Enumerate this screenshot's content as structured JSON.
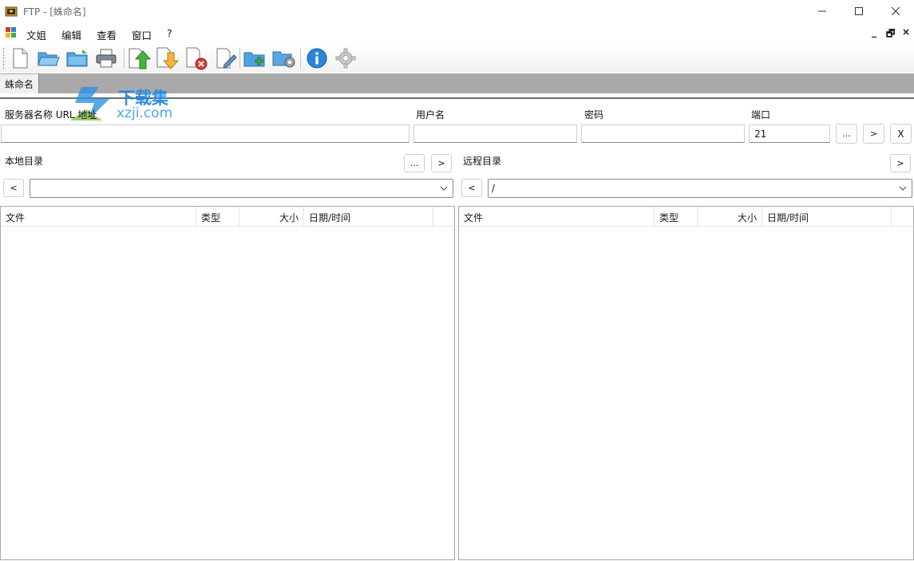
{
  "window": {
    "title": "FTP - [蛛命名]",
    "controls": [
      "minimize",
      "maximize",
      "close"
    ]
  },
  "menu": {
    "items": [
      "文姐",
      "编辑",
      "查看",
      "窗口",
      "?"
    ],
    "mdi": [
      "_",
      "🗗",
      "×"
    ]
  },
  "toolbar": {
    "icons": [
      "new-document-icon",
      "open-folder-icon",
      "save-folder-icon",
      "print-icon",
      "upload-icon",
      "download-icon",
      "delete-icon",
      "edit-icon",
      "new-folder-icon",
      "folder-settings-icon",
      "info-icon",
      "settings-gear-icon"
    ]
  },
  "tabs": {
    "active": "蛛命名"
  },
  "connection": {
    "server_label": "服务器名称 URL 地址",
    "user_label": "用户名",
    "password_label": "密码",
    "port_label": "端口",
    "port_value": "21",
    "browse_button": "...",
    "connect_button": ">",
    "disconnect_button": "X"
  },
  "local": {
    "label": "本地目录",
    "browse_button": "...",
    "go_button": ">",
    "back_button": "<",
    "path": "",
    "columns": [
      "文件",
      "类型",
      "大小",
      "日期/时间"
    ]
  },
  "remote": {
    "label": "远程目录",
    "go_button": ">",
    "back_button": "<",
    "path": "/",
    "columns": [
      "文件",
      "类型",
      "大小",
      "日期/时间"
    ]
  },
  "watermark": {
    "text_cn": "下载集",
    "text_en": "xzji.com"
  }
}
